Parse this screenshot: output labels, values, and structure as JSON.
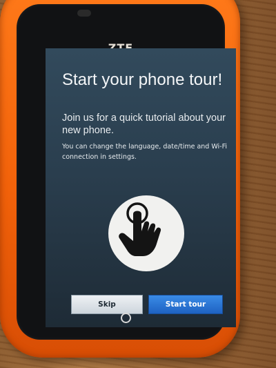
{
  "device": {
    "brand": "ZTE"
  },
  "tour": {
    "title": "Start your phone tour!",
    "subtitle": "Join us for a quick tutorial about your new phone.",
    "note": "You can change the language, date/time and Wi-Fi connection in settings.",
    "illustration_icon": "tap-hand-icon"
  },
  "buttons": {
    "skip_label": "Skip",
    "start_label": "Start tour"
  },
  "colors": {
    "phone_body": "#f2620a",
    "screen_bg": "#2a3e4e",
    "start_button": "#1e62c2",
    "skip_button": "#cdd5dc"
  }
}
